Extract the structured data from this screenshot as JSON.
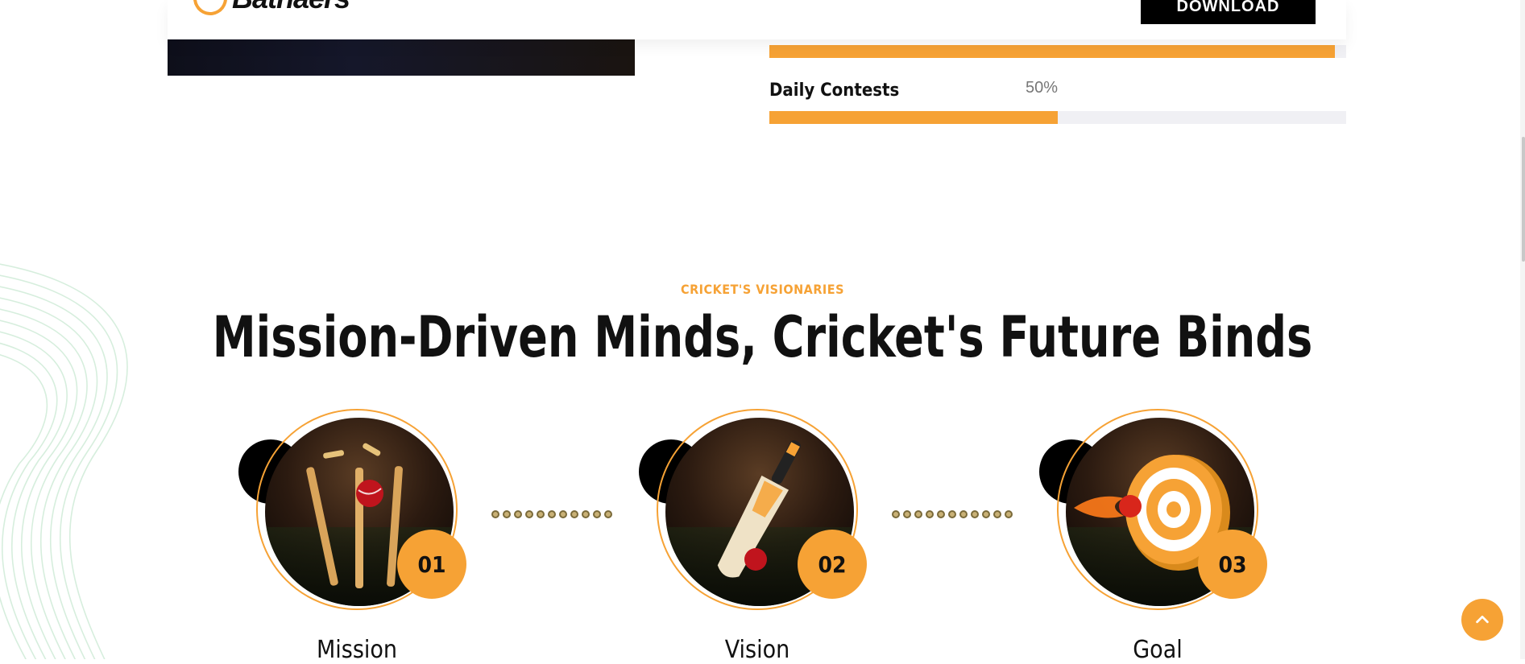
{
  "header": {
    "logo_text": "Batnaers",
    "download_label": "DOWNLOAD"
  },
  "stats": {
    "top_bar": {
      "progress_percent": 98
    },
    "daily_contests": {
      "label": "Daily Contests",
      "value_text": "50%",
      "progress_percent": 50
    }
  },
  "section": {
    "eyebrow": "CRICKET'S VISIONARIES",
    "title": "Mission-Driven Minds, Cricket's Future Binds"
  },
  "items": [
    {
      "number": "01",
      "title": "Mission",
      "icon": "cricket-stumps-icon"
    },
    {
      "number": "02",
      "title": "Vision",
      "icon": "cricket-bat-icon"
    },
    {
      "number": "03",
      "title": "Goal",
      "icon": "target-icon"
    }
  ],
  "colors": {
    "accent": "#f6a235",
    "dark": "#000000",
    "track": "#f0f0f4"
  }
}
